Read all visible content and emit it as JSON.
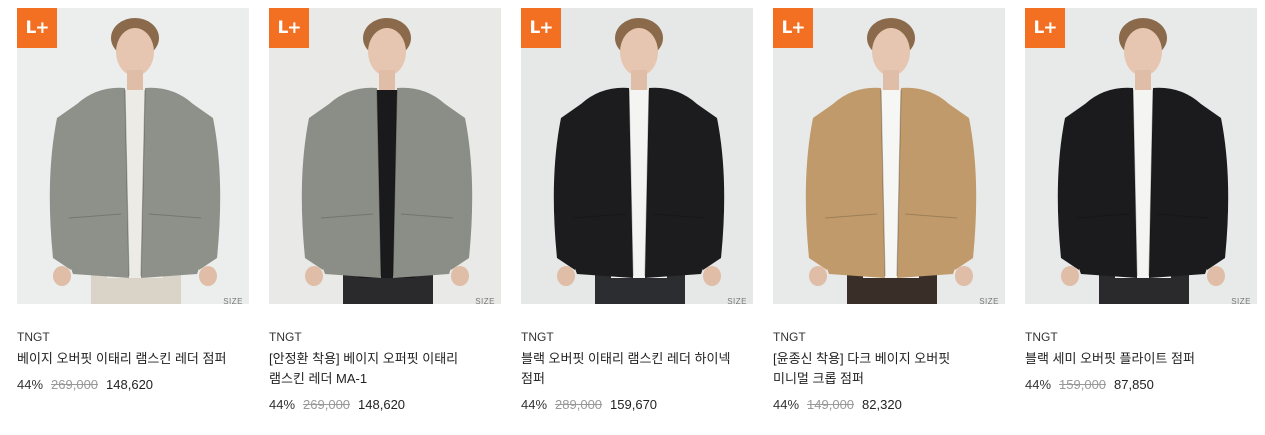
{
  "products": [
    {
      "badge": "L+",
      "size_label": "SIZE",
      "brand": "TNGT",
      "name": "베이지 오버핏 이태리 램스킨 레더 점퍼",
      "discount": "44%",
      "original_price": "269,000",
      "sale_price": "148,620",
      "jacket_color": "#8e918a",
      "inner_color": "#ecebe6",
      "bottom_color": "#d9d3c8",
      "bg_color": "#eceeee"
    },
    {
      "badge": "L+",
      "size_label": "SIZE",
      "brand": "TNGT",
      "name": "[안정환 착용] 베이지 오퍼핏 이태리 램스킨 레더 MA-1",
      "discount": "44%",
      "original_price": "269,000",
      "sale_price": "148,620",
      "jacket_color": "#8b8e86",
      "inner_color": "#1a1a1c",
      "bottom_color": "#2a2a2c",
      "bg_color": "#e9eae8"
    },
    {
      "badge": "L+",
      "size_label": "SIZE",
      "brand": "TNGT",
      "name": "블랙 오버핏 이태리 램스킨 레더 하이넥 점퍼",
      "discount": "44%",
      "original_price": "289,000",
      "sale_price": "159,670",
      "jacket_color": "#1c1c1e",
      "inner_color": "#f4f4f2",
      "bottom_color": "#2b2d31",
      "bg_color": "#e6e8e8"
    },
    {
      "badge": "L+",
      "size_label": "SIZE",
      "brand": "TNGT",
      "name": "[윤종신 착용] 다크 베이지 오버핏 미니멀 크롭 점퍼",
      "discount": "44%",
      "original_price": "149,000",
      "sale_price": "82,320",
      "jacket_color": "#c09a6b",
      "inner_color": "#f6f6f4",
      "bottom_color": "#3a2f28",
      "bg_color": "#e8eaea"
    },
    {
      "badge": "L+",
      "size_label": "SIZE",
      "brand": "TNGT",
      "name": "블랙 세미 오버핏 플라이트 점퍼",
      "discount": "44%",
      "original_price": "159,000",
      "sale_price": "87,850",
      "jacket_color": "#1b1b1d",
      "inner_color": "#f4f4f2",
      "bottom_color": "#2a2a2c",
      "bg_color": "#e8eaea"
    }
  ]
}
